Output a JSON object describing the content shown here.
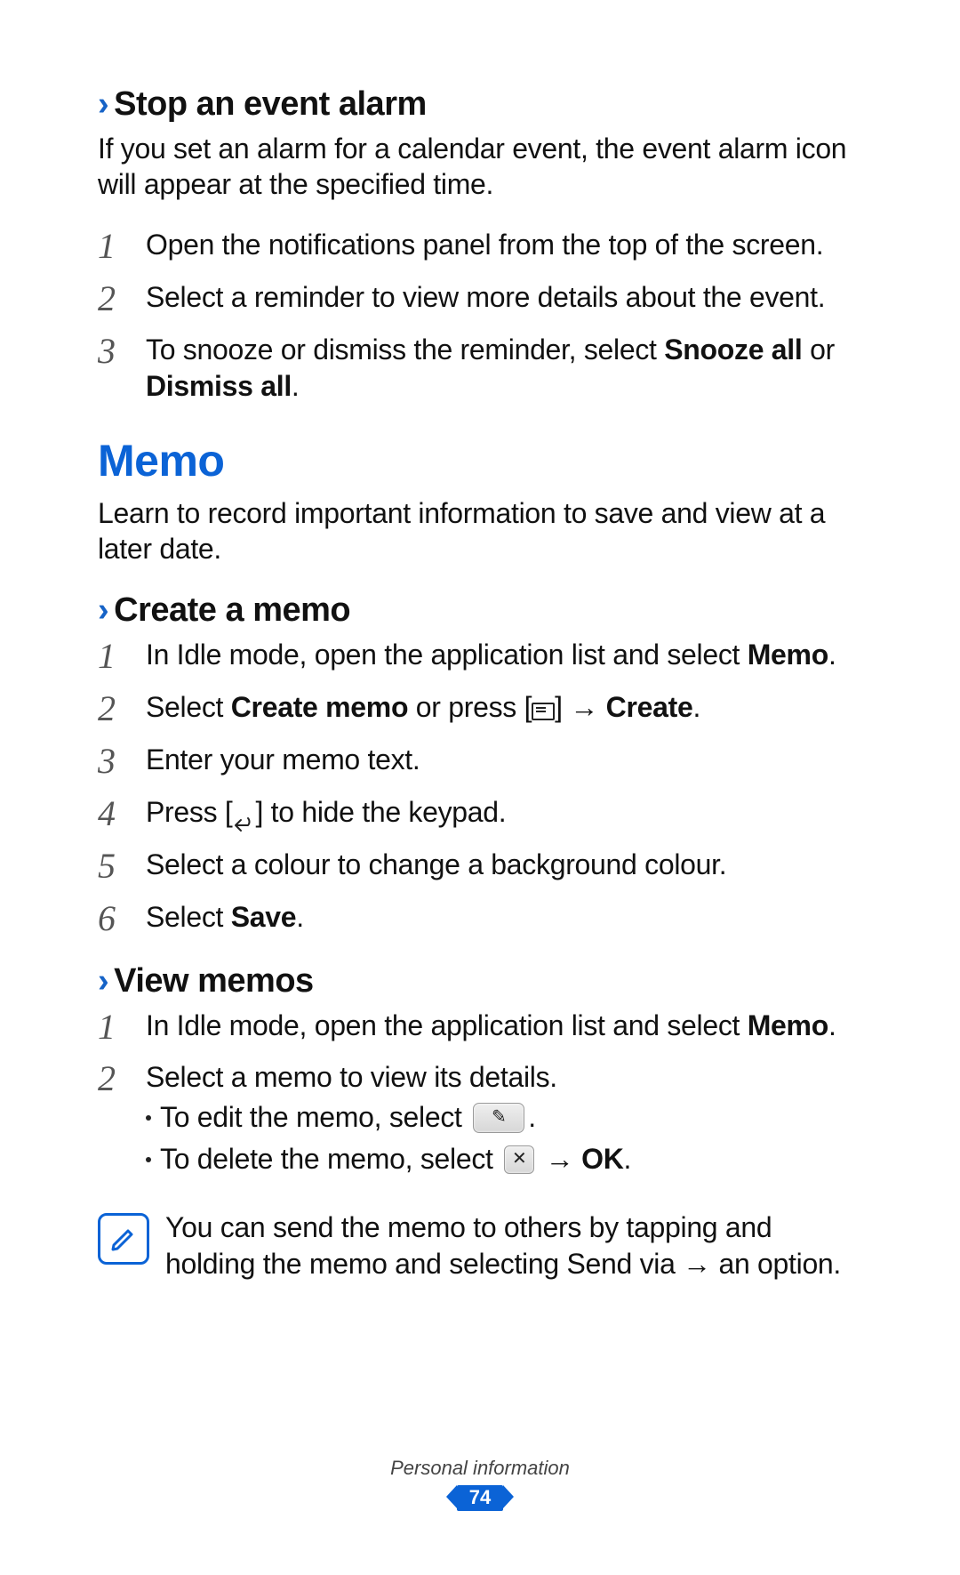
{
  "section_stop": {
    "heading": "Stop an event alarm",
    "body": "If you set an alarm for a calendar event, the event alarm icon will appear at the specified time.",
    "steps": [
      {
        "n": "1",
        "html": "Open the notifications panel from the top of the screen."
      },
      {
        "n": "2",
        "html": "Select a reminder to view more details about the event."
      },
      {
        "n": "3",
        "html": "To snooze or dismiss the reminder, select <span class='b'>Snooze all</span> or <span class='b'>Dismiss all</span>."
      }
    ]
  },
  "section_memo": {
    "title": "Memo",
    "intro": "Learn to record important information to save and view at a later date."
  },
  "section_create": {
    "heading": "Create a memo",
    "steps": [
      {
        "n": "1",
        "html": "In Idle mode, open the application list and select <span class='b'>Memo</span>."
      },
      {
        "n": "2",
        "html": "Select <span class='b'>Create memo</span> or press [<span class='icon-bracket'><span class='menu-glyph' data-name='menu-icon' data-interactable='false'></span></span>] → <span class='b'>Create</span>."
      },
      {
        "n": "3",
        "html": "Enter your memo text."
      },
      {
        "n": "4",
        "html": "Press [<span class='icon-bracket'><span class='back-glyph' data-name='back-icon' data-interactable='false'><svg viewBox='0 0 26 20'><path d='M4 10 L10 4 M4 10 L10 16 M4 10 H18 A6 6 0 0 0 18 2' fill='none' stroke='#222' stroke-width='2' stroke-linecap='round' stroke-linejoin='round'/></svg></span></span>] to hide the keypad."
      },
      {
        "n": "5",
        "html": "Select a colour to change a background colour."
      },
      {
        "n": "6",
        "html": "Select <span class='b'>Save</span>."
      }
    ]
  },
  "section_view": {
    "heading": "View memos",
    "steps": [
      {
        "n": "1",
        "html": "In Idle mode, open the application list and select <span class='b'>Memo</span>."
      },
      {
        "n": "2",
        "html": "Select a memo to view its details.",
        "bullets": [
          "To edit the memo, select <span class='icon-btn' data-name='edit-icon' data-interactable='false'>✎</span>.",
          "To delete the memo, select <span class='icon-btn small' data-name='delete-icon' data-interactable='false'>✕</span> → <span class='b'>OK</span>."
        ]
      }
    ],
    "note": "You can send the memo to others by tapping and holding the memo and selecting <span class='b'>Send via</span> → an option."
  },
  "footer": {
    "category": "Personal information",
    "page": "74"
  }
}
